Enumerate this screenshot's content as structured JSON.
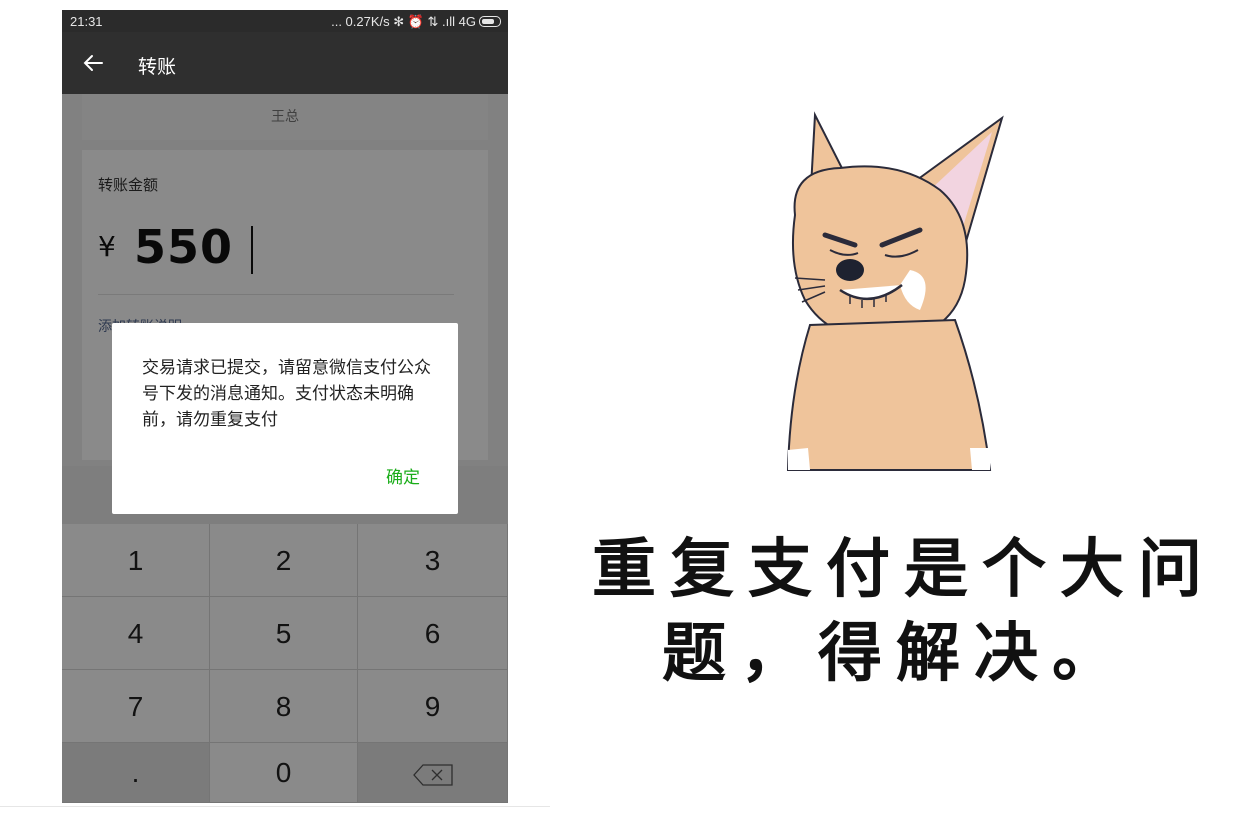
{
  "status_bar": {
    "time": "21:31",
    "indicators": "... 0.27K/s ✻ ⏰ ⇅ .ıll 4G"
  },
  "header": {
    "back_icon": "arrow-left-icon",
    "title": "转账"
  },
  "payee": {
    "name": "王总"
  },
  "transfer": {
    "amount_label": "转账金额",
    "currency_symbol": "¥",
    "amount": "550",
    "add_note_link": "添加转账说明"
  },
  "dialog": {
    "message": "交易请求已提交，请留意微信支付公众号下发的消息通知。支付状态未明确前，请勿重复支付",
    "confirm_label": "确定"
  },
  "keypad": {
    "keys": [
      "1",
      "2",
      "3",
      "4",
      "5",
      "6",
      "7",
      "8",
      "9",
      ".",
      "0"
    ],
    "backspace_icon": "backspace-icon"
  },
  "meme": {
    "caption_line1": "重复支付是个大问",
    "caption_line2": "题，得解决。"
  },
  "colors": {
    "accent_green": "#1aad19",
    "link_blue": "#576b95",
    "titlebar": "#2f2f2f"
  }
}
